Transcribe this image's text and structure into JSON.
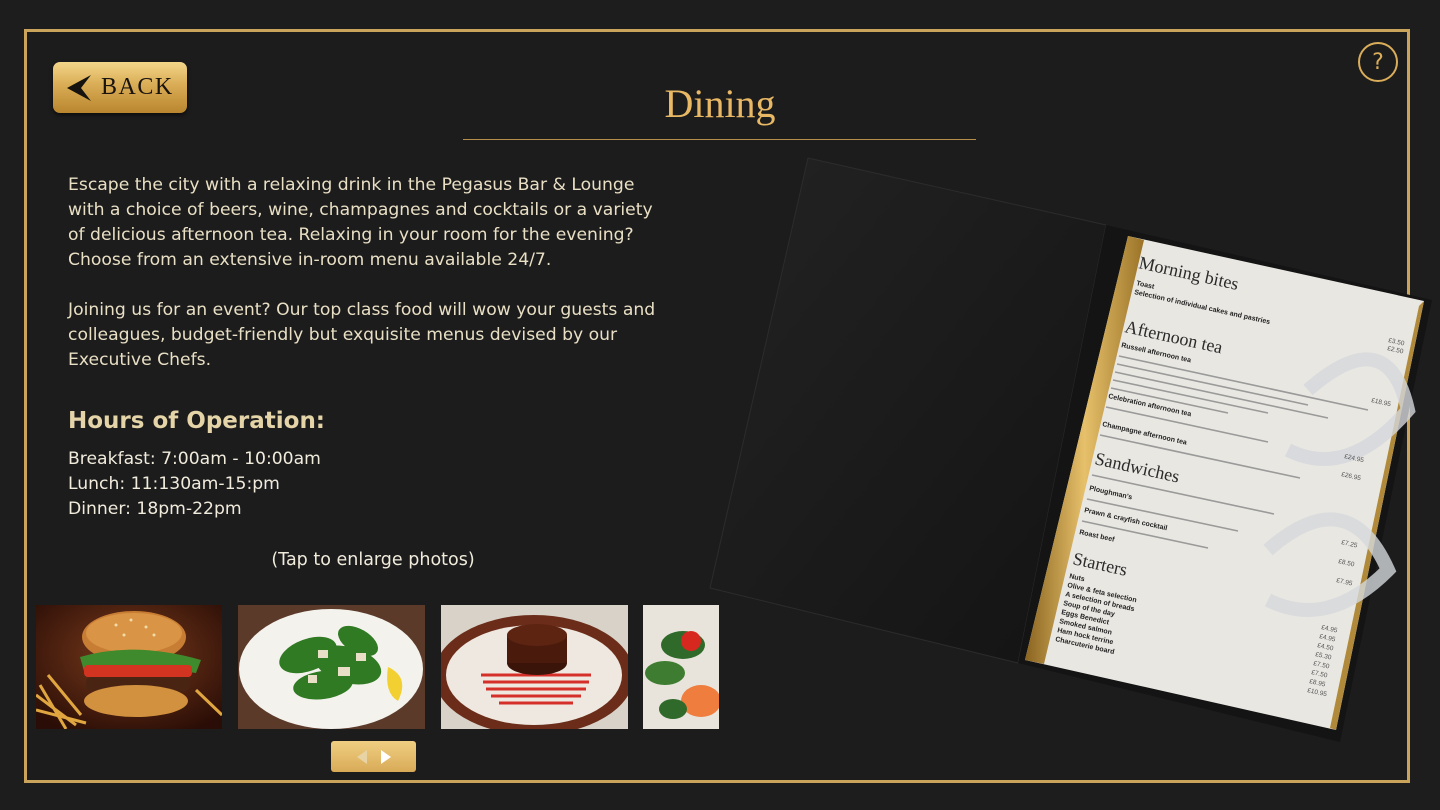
{
  "header": {
    "back_label": "BACK",
    "title": "Dining",
    "help_label": "?"
  },
  "intro": {
    "paragraphs": [
      "Escape the city with a relaxing drink in the Pegasus Bar & Lounge with a choice of beers, wine, champagnes and cocktails or a variety of delicious afternoon tea. Relaxing in your room for the evening? Choose from an extensive in-room menu available 24/7.",
      "Joining us for an event? Our top class food will wow your guests and colleagues, budget-friendly but exquisite menus devised by our Executive Chefs."
    ]
  },
  "hours": {
    "title": "Hours of Operation:",
    "lines": [
      "Breakfast: 7:00am - 10:00am",
      "Lunch: 11:130am-15:pm",
      "Dinner: 18pm-22pm"
    ]
  },
  "gallery": {
    "caption": "(Tap to enlarge photos)",
    "photos": [
      "burger-photo",
      "caesar-salad-photo",
      "chocolate-dessert-photo",
      "salmon-salad-photo"
    ]
  },
  "menu_card": {
    "sections": [
      {
        "heading": "Morning bites",
        "items": [
          "Toast",
          "Selection of individual cakes and pastries"
        ]
      },
      {
        "heading": "Afternoon tea",
        "items": [
          "Russell afternoon tea",
          "Celebration afternoon tea",
          "Champagne afternoon tea"
        ]
      },
      {
        "heading": "Sandwiches",
        "items": [
          "Ploughman's",
          "Prawn & crayfish cocktail",
          "Roast beef"
        ]
      },
      {
        "heading": "Starters",
        "items": [
          "Nuts",
          "Olive & feta selection",
          "A selection of breads",
          "Soup of the day",
          "Eggs Benedict",
          "Smoked salmon",
          "Ham hock terrine",
          "Charcuterie board"
        ]
      }
    ],
    "prices": [
      "£3.50",
      "£2.50",
      "£18.95",
      "£24.95",
      "£26.95",
      "£7.25",
      "£8.50",
      "£7.95",
      "£4.95",
      "£4.95",
      "£4.50",
      "£5.30",
      "£7.50",
      "£7.50",
      "£8.95",
      "£10.95"
    ]
  },
  "colors": {
    "gold": "#c9a45a",
    "title_gold": "#e9b865",
    "background": "#1c1c1d"
  }
}
